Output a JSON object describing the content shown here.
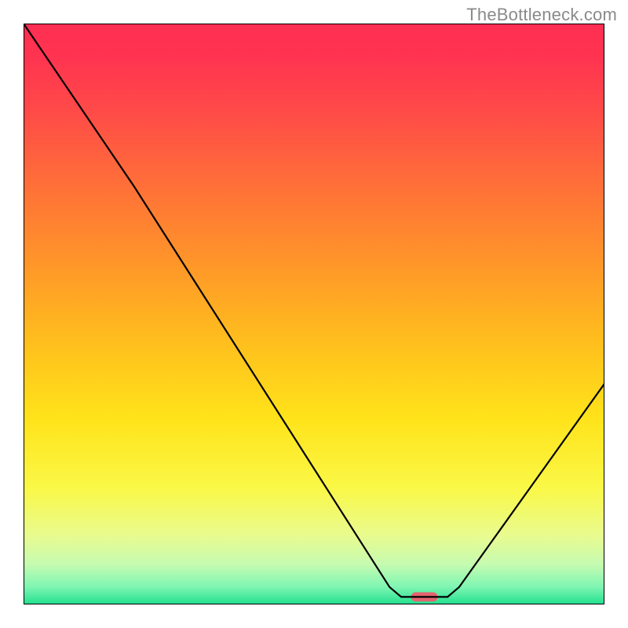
{
  "watermark": "TheBottleneck.com",
  "chart_data": {
    "type": "line",
    "title": "",
    "xlabel": "",
    "ylabel": "",
    "xlim": [
      0,
      100
    ],
    "ylim": [
      0,
      100
    ],
    "background_gradient": {
      "stops": [
        {
          "offset": 0.0,
          "color": "#ff2e52"
        },
        {
          "offset": 0.06,
          "color": "#ff3450"
        },
        {
          "offset": 0.15,
          "color": "#ff4a48"
        },
        {
          "offset": 0.28,
          "color": "#ff7038"
        },
        {
          "offset": 0.42,
          "color": "#ff9828"
        },
        {
          "offset": 0.55,
          "color": "#ffbf1d"
        },
        {
          "offset": 0.68,
          "color": "#ffe31a"
        },
        {
          "offset": 0.8,
          "color": "#faf847"
        },
        {
          "offset": 0.88,
          "color": "#e9fb8e"
        },
        {
          "offset": 0.93,
          "color": "#c7fbb0"
        },
        {
          "offset": 0.97,
          "color": "#7ef6b2"
        },
        {
          "offset": 1.0,
          "color": "#22e08f"
        }
      ]
    },
    "series": [
      {
        "name": "bottleneck-curve",
        "type": "line",
        "color": "#000000",
        "points": [
          {
            "x": 0,
            "y": 100
          },
          {
            "x": 19,
            "y": 72
          },
          {
            "x": 63,
            "y": 3
          },
          {
            "x": 65,
            "y": 1.3
          },
          {
            "x": 73,
            "y": 1.3
          },
          {
            "x": 75,
            "y": 3
          },
          {
            "x": 100,
            "y": 38
          }
        ]
      }
    ],
    "markers": [
      {
        "name": "optimum-marker",
        "x": 69,
        "y": 1.3,
        "color": "#e4636f",
        "width_pct": 4.6,
        "height_pct": 1.6
      }
    ],
    "axes": {
      "show_ticks": false,
      "show_grid": false,
      "frame_color": "#000000",
      "frame_width": 2
    }
  }
}
